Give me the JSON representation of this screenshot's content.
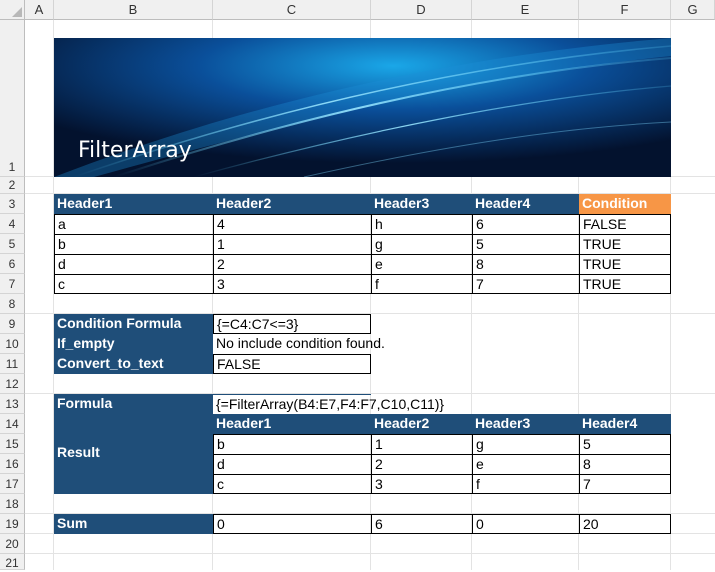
{
  "columns": [
    "A",
    "B",
    "C",
    "D",
    "E",
    "F",
    "G"
  ],
  "rows": [
    "1",
    "2",
    "3",
    "4",
    "5",
    "6",
    "7",
    "8",
    "9",
    "10",
    "11",
    "12",
    "13",
    "14",
    "15",
    "16",
    "17",
    "18",
    "19",
    "20",
    "21"
  ],
  "banner": {
    "title": "FilterArray"
  },
  "table": {
    "headers": [
      "Header1",
      "Header2",
      "Header3",
      "Header4",
      "Condition"
    ],
    "rows": [
      [
        "a",
        "4",
        "h",
        "6",
        "FALSE"
      ],
      [
        "b",
        "1",
        "g",
        "5",
        "TRUE"
      ],
      [
        "d",
        "2",
        "e",
        "8",
        "TRUE"
      ],
      [
        "c",
        "3",
        "f",
        "7",
        "TRUE"
      ]
    ]
  },
  "params": {
    "condition_label": "Condition Formula",
    "condition_value": "{=C4:C7<=3}",
    "ifempty_label": "If_empty",
    "ifempty_value": "No include condition found.",
    "convert_label": "Convert_to_text",
    "convert_value": "FALSE"
  },
  "formula": {
    "label": "Formula",
    "value": "{=FilterArray(B4:E7,F4:F7,C10,C11)}"
  },
  "result": {
    "label": "Result",
    "headers": [
      "Header1",
      "Header2",
      "Header3",
      "Header4"
    ],
    "rows": [
      [
        "b",
        "1",
        "g",
        "5"
      ],
      [
        "d",
        "2",
        "e",
        "8"
      ],
      [
        "c",
        "3",
        "f",
        "7"
      ]
    ]
  },
  "sum": {
    "label": "Sum",
    "values": [
      "0",
      "6",
      "0",
      "20"
    ]
  },
  "colors": {
    "header_blue": "#1f4e79",
    "condition_orange": "#f79646"
  }
}
